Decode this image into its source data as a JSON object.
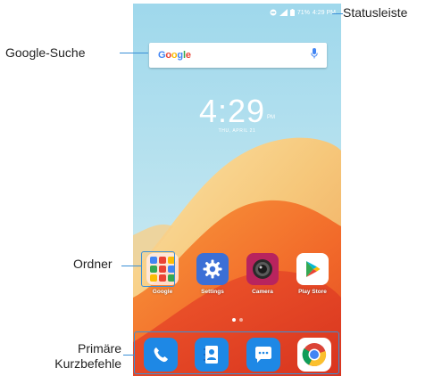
{
  "annotations": {
    "status_bar": "Statusleiste",
    "google_search": "Google-Suche",
    "folder": "Ordner",
    "primary_shortcuts_line1": "Primäre",
    "primary_shortcuts_line2": "Kurzbefehle"
  },
  "status_bar": {
    "icons": [
      "do-not-disturb-icon",
      "signal-icon",
      "battery-icon"
    ],
    "battery": "71%",
    "time": "4:29 PM"
  },
  "search": {
    "logo": [
      "G",
      "o",
      "o",
      "g",
      "l",
      "e"
    ],
    "logo_colors": [
      "#4285f4",
      "#ea4335",
      "#fbbc05",
      "#4285f4",
      "#34a853",
      "#ea4335"
    ],
    "mic_icon": "mic-icon"
  },
  "clock": {
    "time": "4:29",
    "ampm": "PM",
    "date": "THU, APRIL 21"
  },
  "apps": [
    {
      "label": "Google",
      "icon": "folder-icon"
    },
    {
      "label": "Settings",
      "icon": "gear-icon"
    },
    {
      "label": "Camera",
      "icon": "camera-icon"
    },
    {
      "label": "Play Store",
      "icon": "play-store-icon"
    }
  ],
  "dock": [
    {
      "icon": "phone-icon",
      "color": "#1e88e5"
    },
    {
      "icon": "contacts-icon",
      "color": "#1e88e5"
    },
    {
      "icon": "messages-icon",
      "color": "#1e88e5"
    },
    {
      "icon": "chrome-icon",
      "color": "#ffffff"
    }
  ],
  "colors": {
    "leader": "#3a8fd6",
    "wallpaper_sky": "#bfe6f2",
    "wallpaper_orange": "#f26a2a"
  }
}
